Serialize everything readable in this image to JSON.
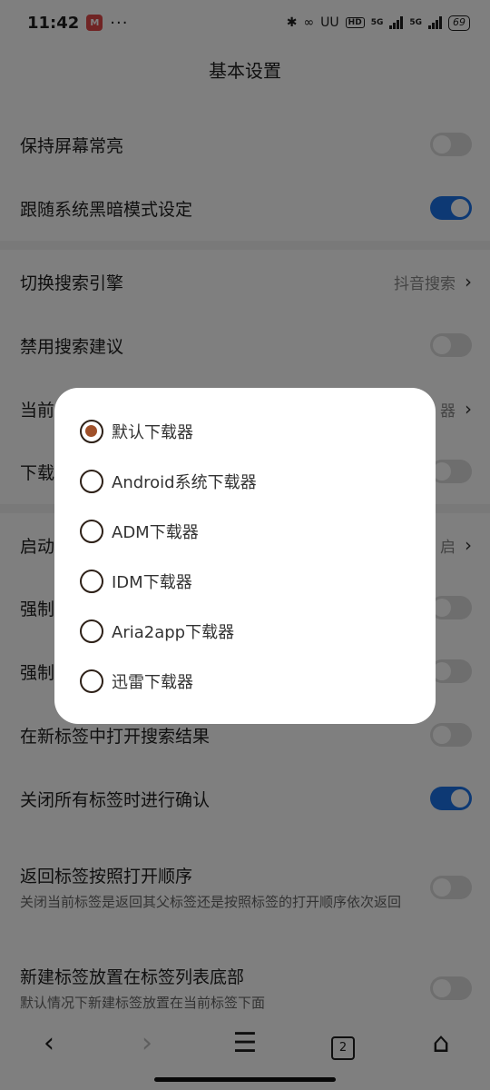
{
  "status_bar": {
    "time": "11:42",
    "app_badge": "M",
    "dots": "···",
    "hd": "HD",
    "net1": "5G",
    "net2": "5G",
    "battery": "69"
  },
  "page_title": "基本设置",
  "settings": [
    {
      "label": "保持屏幕常亮",
      "toggle": false
    },
    {
      "label": "跟随系统黑暗模式设定",
      "toggle": true
    },
    {
      "label": "切换搜索引擎",
      "value": "抖音搜索"
    },
    {
      "label": "禁用搜索建议",
      "toggle": false
    },
    {
      "label": "当前",
      "value": "器"
    },
    {
      "label": "下载",
      "toggle": false
    },
    {
      "label": "启动",
      "value": "启"
    },
    {
      "label": "强制",
      "toggle": false
    },
    {
      "label": "强制",
      "toggle": false
    },
    {
      "label": "在新标签中打开搜索结果",
      "toggle": false
    },
    {
      "label": "关闭所有标签时进行确认",
      "toggle": true
    },
    {
      "label": "返回标签按照打开顺序",
      "sub": "关闭当前标签是返回其父标签还是按照标签的打开顺序依次返回",
      "toggle": false
    },
    {
      "label": "新建标签放置在标签列表底部",
      "sub": "默认情况下新建标签放置在当前标签下面",
      "toggle": false
    }
  ],
  "chevron": "›",
  "bottom_nav": {
    "back": "‹",
    "forward": "›",
    "menu": "☰",
    "tab_count": "2",
    "home": "⌂"
  },
  "dialog": {
    "options": [
      {
        "label": "默认下载器",
        "selected": true
      },
      {
        "label": "Android系统下载器",
        "selected": false
      },
      {
        "label": "ADM下载器",
        "selected": false
      },
      {
        "label": "IDM下载器",
        "selected": false
      },
      {
        "label": "Aria2app下载器",
        "selected": false
      },
      {
        "label": "迅雷下载器",
        "selected": false
      }
    ]
  }
}
